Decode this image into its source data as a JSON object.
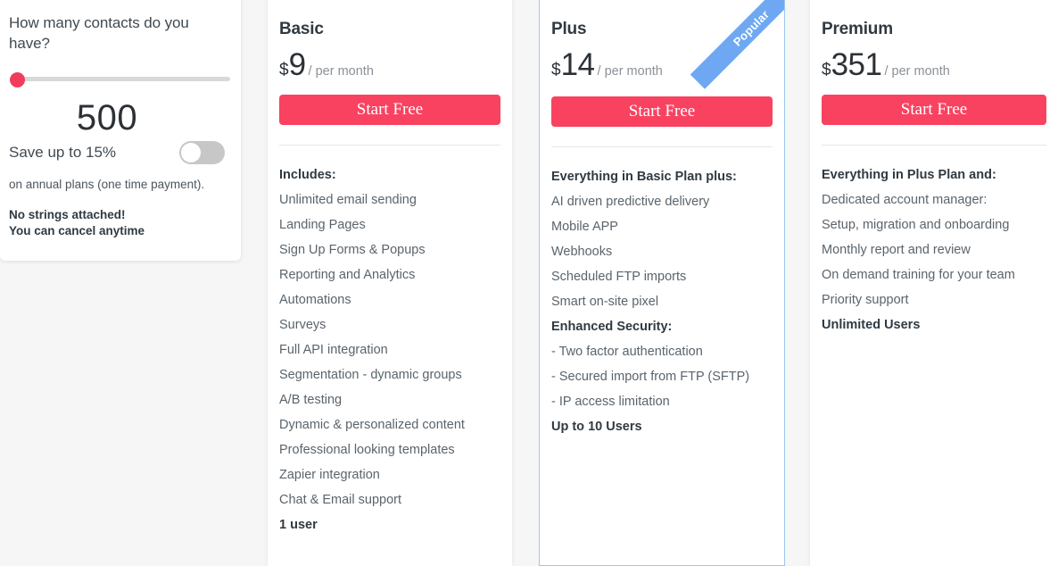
{
  "calculator": {
    "question": "How many contacts do you have?",
    "slider": {
      "value": 500,
      "position_percent": 0
    },
    "contacts_value": "500",
    "save_label": "Save up to 15%",
    "toggle": {
      "state": "off"
    },
    "annual_note": "on annual plans (one time payment).",
    "no_strings_line1": "No strings attached!",
    "no_strings_line2": "You can cancel anytime"
  },
  "plans": [
    {
      "name": "Basic",
      "currency": "$",
      "amount": "9",
      "period": "/ per month",
      "cta": "Start Free",
      "features": [
        {
          "text": "Includes:",
          "bold": true
        },
        {
          "text": "Unlimited email sending",
          "bold": false
        },
        {
          "text": "Landing Pages",
          "bold": false
        },
        {
          "text": "Sign Up Forms & Popups",
          "bold": false
        },
        {
          "text": "Reporting and Analytics",
          "bold": false
        },
        {
          "text": "Automations",
          "bold": false
        },
        {
          "text": "Surveys",
          "bold": false
        },
        {
          "text": "Full API integration",
          "bold": false
        },
        {
          "text": "Segmentation - dynamic groups",
          "bold": false
        },
        {
          "text": "A/B testing",
          "bold": false
        },
        {
          "text": "Dynamic & personalized content",
          "bold": false
        },
        {
          "text": "Professional looking templates",
          "bold": false
        },
        {
          "text": "Zapier integration",
          "bold": false
        },
        {
          "text": "Chat & Email support",
          "bold": false
        },
        {
          "text": "1 user",
          "bold": true
        }
      ]
    },
    {
      "name": "Plus",
      "currency": "$",
      "amount": "14",
      "period": "/ per month",
      "cta": "Start Free",
      "badge": "Popular",
      "features": [
        {
          "text": "Everything in Basic Plan plus:",
          "bold": true
        },
        {
          "text": "AI driven predictive delivery",
          "bold": false
        },
        {
          "text": "Mobile APP",
          "bold": false
        },
        {
          "text": "Webhooks",
          "bold": false
        },
        {
          "text": "Scheduled FTP imports",
          "bold": false
        },
        {
          "text": "Smart on-site pixel",
          "bold": false
        },
        {
          "text": "Enhanced Security:",
          "bold": true
        },
        {
          "text": "- Two factor authentication",
          "bold": false
        },
        {
          "text": "- Secured import from FTP (SFTP)",
          "bold": false
        },
        {
          "text": "- IP access limitation",
          "bold": false
        },
        {
          "text": "Up to 10 Users",
          "bold": true
        }
      ]
    },
    {
      "name": "Premium",
      "currency": "$",
      "amount": "351",
      "period": "/ per month",
      "cta": "Start Free",
      "features": [
        {
          "text": "Everything in Plus Plan and:",
          "bold": true
        },
        {
          "text": "Dedicated account manager:",
          "bold": false
        },
        {
          "text": "Setup, migration and onboarding",
          "bold": false
        },
        {
          "text": "Monthly report and review",
          "bold": false
        },
        {
          "text": "On demand training for your team",
          "bold": false
        },
        {
          "text": "Priority support",
          "bold": false
        },
        {
          "text": "Unlimited Users",
          "bold": true
        }
      ]
    }
  ],
  "colors": {
    "accent_pink": "#f94260",
    "ribbon_blue": "#6ea8f2",
    "page_background": "#f6f6f6",
    "plus_border": "#9ec5f0"
  }
}
